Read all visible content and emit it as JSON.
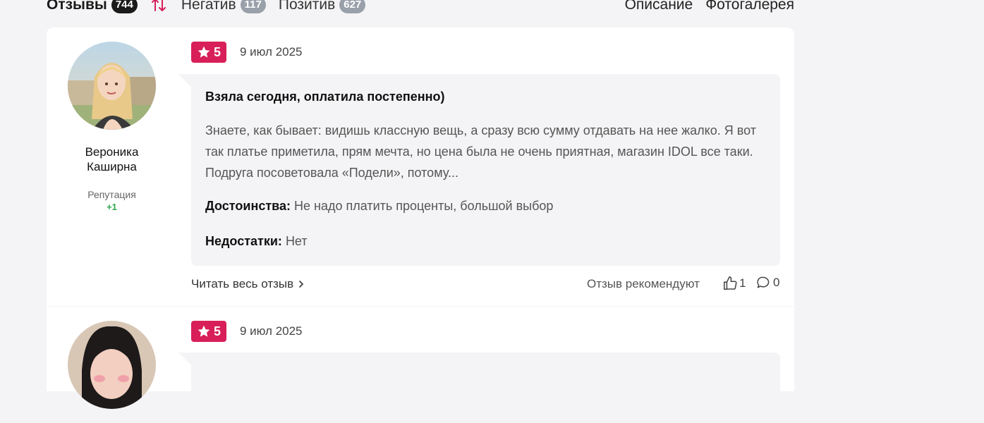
{
  "tabs": [
    {
      "label": "Отзывы",
      "count": "744"
    },
    {
      "label": "Негатив",
      "count": "117"
    },
    {
      "label": "Позитив",
      "count": "627"
    }
  ],
  "links": {
    "description": "Описание",
    "gallery": "Фотогалерея"
  },
  "icons": [
    "sort-arrows-icon",
    "star-icon",
    "chevron-right-icon",
    "thumbs-up-icon",
    "comment-icon"
  ],
  "colors": {
    "rating_badge": "#d81f5a",
    "reputation": "#2fa84f",
    "active_count": "#1a1a1a",
    "inactive_count": "#9aa0aa"
  },
  "reviews": [
    {
      "author": "Вероника Каширна",
      "reputation_label": "Репутация",
      "reputation_value": "+1",
      "rating": "5",
      "date": "9 июл 2025",
      "title": "Взяла сегодня, оплатила постепенно)",
      "text": "Знаете, как бывает: видишь классную вещь, а сразу всю сумму отдавать на нее жалко. Я вот так платье приметила, прям мечта, но цена была не очень приятная, магазин IDOL все таки. Подруга посоветовала «Подели», потому...",
      "pros_label": "Достоинства:",
      "pros": "Не надо платить проценты, большой выбор",
      "cons_label": "Недостатки:",
      "cons": "Нет",
      "read_more": "Читать весь отзыв",
      "recommend_label": "Отзыв рекомендуют",
      "likes": "1",
      "comments": "0"
    },
    {
      "rating": "5",
      "date": "9 июл 2025"
    }
  ]
}
